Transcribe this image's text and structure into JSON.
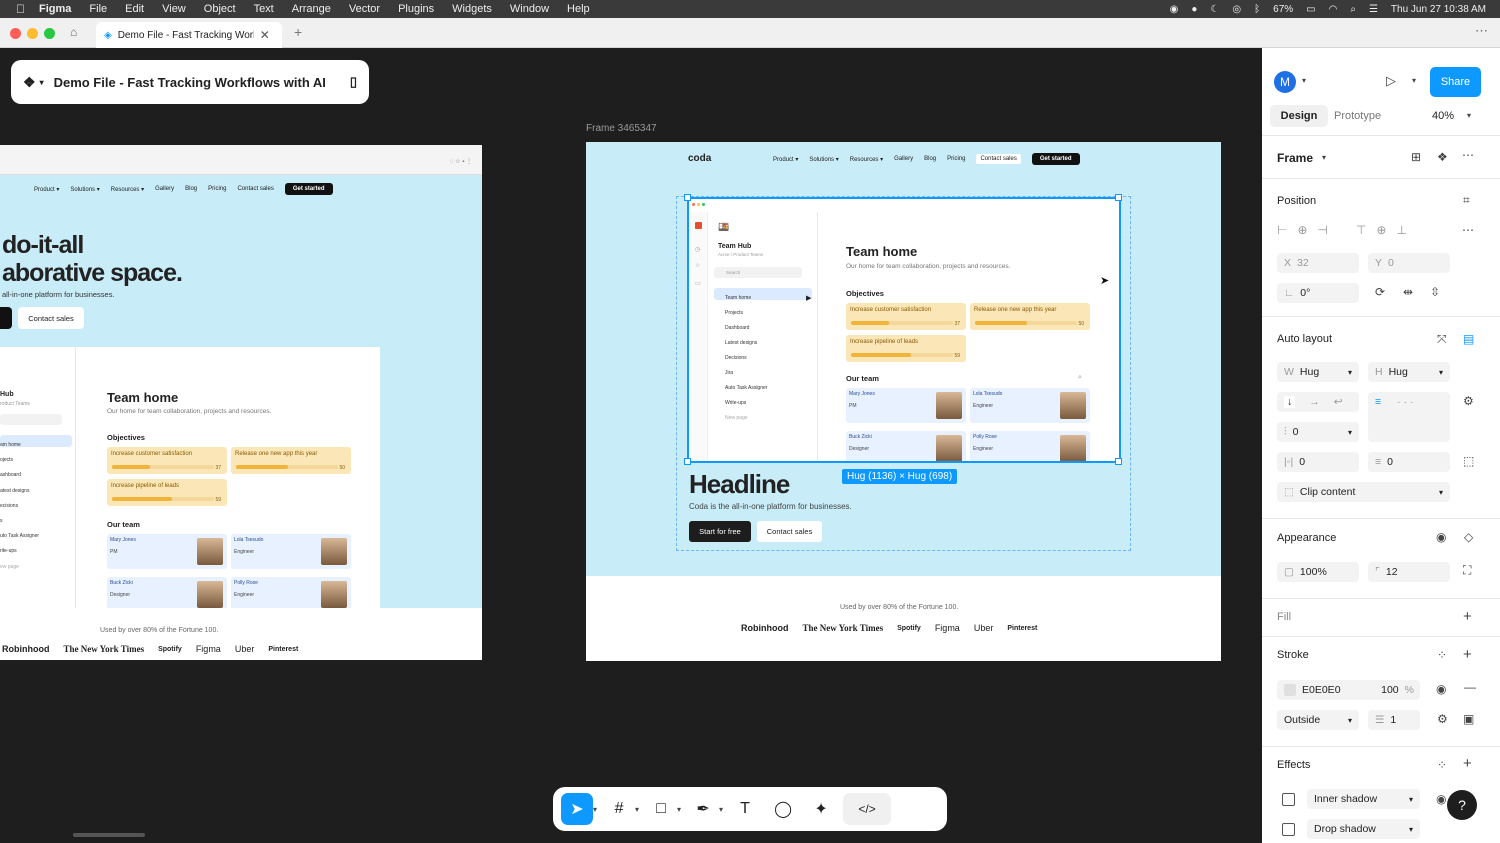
{
  "menubar": {
    "app_name": "Figma",
    "items": [
      "File",
      "Edit",
      "View",
      "Object",
      "Text",
      "Arrange",
      "Vector",
      "Plugins",
      "Widgets",
      "Window",
      "Help"
    ],
    "battery": "67%",
    "datetime": "Thu Jun 27  10:38 AM"
  },
  "browser": {
    "tab_title": "Demo File - Fast Tracking Workfl",
    "new_tab": "+"
  },
  "file": {
    "title": "Demo File - Fast Tracking Workflows with AI"
  },
  "left_frame": {
    "nav": [
      "Product ▾",
      "Solutions ▾",
      "Resources ▾",
      "Gallery",
      "Blog",
      "Pricing",
      "Contact sales"
    ],
    "cta": "Get started",
    "hero_line1": "do-it-all",
    "hero_line2": "aborative space.",
    "sub": "all-in-one platform for businesses.",
    "btn_contact": "Contact sales",
    "hub_title": "Hub",
    "hub_sub": "roduct Teams",
    "side_items": [
      "am home",
      "ojects",
      "ashboard",
      "atest designs",
      "ecisions",
      "s",
      "uto Task Assigner",
      "rite-ups",
      "ew page"
    ],
    "team_home": "Team home",
    "team_desc": "Our home for team collaboration, projects and resources.",
    "objectives": "Objectives",
    "obj": [
      {
        "label": "Increase customer satisfaction",
        "value": "37",
        "progress": 0.37
      },
      {
        "label": "Release one new app this year",
        "value": "50",
        "progress": 0.5
      },
      {
        "label": "Increase pipeline of leads",
        "value": "59",
        "progress": 0.59
      }
    ],
    "our_team": "Our team",
    "members": [
      {
        "name": "Mary Jones",
        "role": "PM"
      },
      {
        "name": "Lola Tsesudo",
        "role": "Engineer"
      },
      {
        "name": "Buck Zicki",
        "role": "Designer"
      },
      {
        "name": "Polly Rose",
        "role": "Engineer"
      }
    ],
    "used_by": "Used by over 80% of the Fortune 100.",
    "logos": [
      "Robinhood",
      "The New York Times",
      "Spotify",
      "Figma",
      "Uber",
      "Pinterest"
    ]
  },
  "main_frame": {
    "label": "Frame 3465347",
    "brand": "coda",
    "nav": [
      "Product ▾",
      "Solutions ▾",
      "Resources ▾",
      "Gallery",
      "Blog",
      "Pricing",
      "Contact sales"
    ],
    "cta": "Get started",
    "hub_title": "Team Hub",
    "hub_sub": "Acme / Product Teams",
    "search": "Search",
    "side_items": [
      "Team home",
      "Projects",
      "Dashboard",
      "Latest designs",
      "Decisions",
      "Jira",
      "Auto Task Assigner",
      "Write-ups",
      "New page"
    ],
    "team_home": "Team home",
    "team_desc": "Our home for team collaboration, projects and resources.",
    "objectives": "Objectives",
    "obj": [
      {
        "label": "Increase customer satisfaction",
        "value": "37",
        "progress": 0.37
      },
      {
        "label": "Release one new app this year",
        "value": "50",
        "progress": 0.5
      },
      {
        "label": "Increase pipeline of leads",
        "value": "59",
        "progress": 0.59
      }
    ],
    "our_team": "Our team",
    "members": [
      {
        "name": "Mary Jones",
        "role": "PM"
      },
      {
        "name": "Lola Tsesudo",
        "role": "Engineer"
      },
      {
        "name": "Buck Zicki",
        "role": "Designer"
      },
      {
        "name": "Polly Rose",
        "role": "Engineer"
      }
    ],
    "size_badge": "Hug (1136) × Hug (698)",
    "headline": "Headline",
    "subline": "Coda is the all-in-one platform for businesses.",
    "btn_start": "Start for free",
    "btn_contact": "Contact sales",
    "used_by": "Used by over 80% of the Fortune 100.",
    "logos": [
      "Robinhood",
      "The New York Times",
      "Spotify",
      "Figma",
      "Uber",
      "Pinterest"
    ]
  },
  "panel": {
    "avatar": "M",
    "share": "Share",
    "tab_design": "Design",
    "tab_prototype": "Prototype",
    "zoom": "40%",
    "frame_label": "Frame",
    "position": "Position",
    "x_label": "X",
    "x_value": "32",
    "y_label": "Y",
    "y_value": "0",
    "rotation": "0°",
    "auto_layout": "Auto layout",
    "w_label": "W",
    "w_value": "Hug",
    "h_label": "H",
    "h_value": "Hug",
    "gap_value": "0",
    "pad_h": "0",
    "pad_v": "0",
    "clip_content": "Clip content",
    "appearance": "Appearance",
    "opacity": "100%",
    "radius": "12",
    "fill": "Fill",
    "stroke": "Stroke",
    "stroke_color": "E0E0E0",
    "stroke_opacity": "100",
    "stroke_pct": "%",
    "stroke_position": "Outside",
    "stroke_width": "1",
    "effects": "Effects",
    "effect1": "Inner shadow",
    "effect2": "Drop shadow"
  },
  "colors": {
    "accent": "#0d99ff",
    "canvas": "#1e1e1e",
    "frame_bg": "#c8ecf8"
  }
}
